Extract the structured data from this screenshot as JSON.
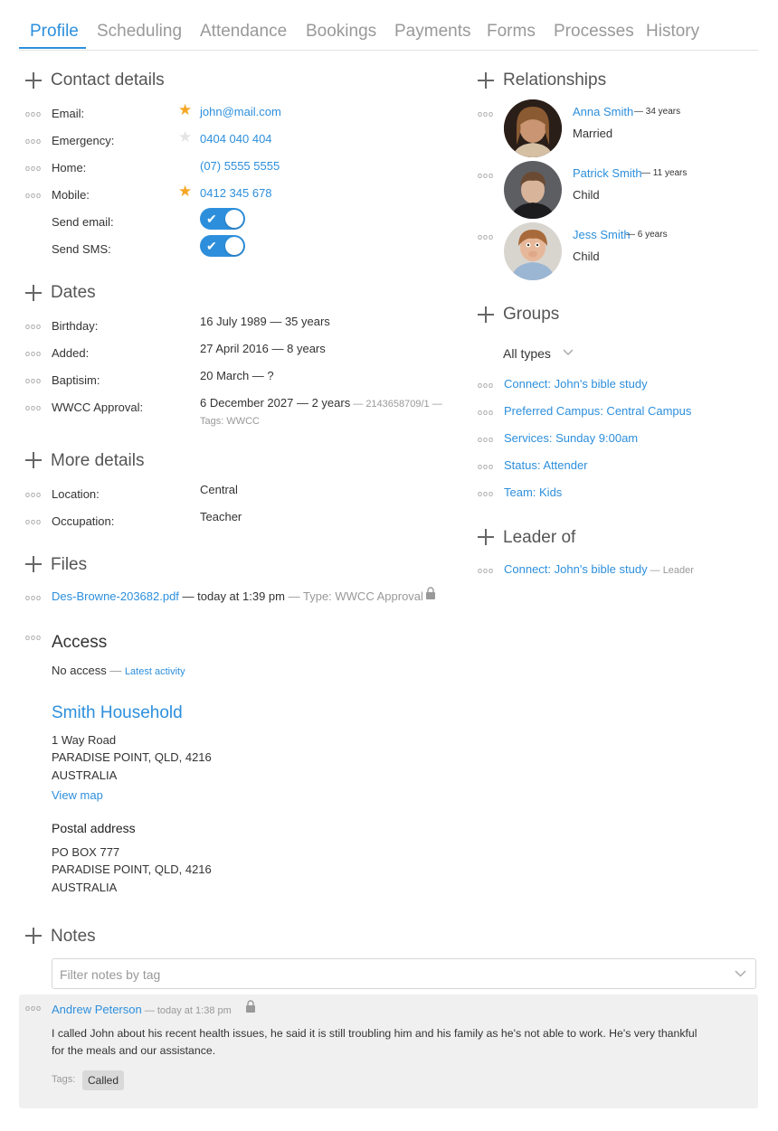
{
  "tabs": [
    "Profile",
    "Scheduling",
    "Attendance",
    "Bookings",
    "Payments",
    "Forms",
    "Processes",
    "History"
  ],
  "contact": {
    "title": "Contact details",
    "email_label": "Email:",
    "email": "john@mail.com",
    "emergency_label": "Emergency:",
    "emergency": "0404 040 404",
    "home_label": "Home:",
    "home": "(07) 5555 5555",
    "mobile_label": "Mobile:",
    "mobile": "0412 345 678",
    "send_email_label": "Send email:",
    "send_sms_label": "Send SMS:"
  },
  "dates": {
    "title": "Dates",
    "birthday_label": "Birthday:",
    "birthday": "16 July 1989 — 35 years",
    "added_label": "Added:",
    "added": "27 April 2016 — 8 years",
    "baptism_label": "Baptisim:",
    "baptism": "20 March — ?",
    "wwcc_label": "WWCC Approval:",
    "wwcc": "6 December 2027 — 2 years",
    "wwcc_extra": " — 2143658709/1 —",
    "wwcc_tags": "Tags: WWCC"
  },
  "more": {
    "title": "More details",
    "location_label": "Location:",
    "location": "Central",
    "occupation_label": "Occupation:",
    "occupation": "Teacher"
  },
  "files": {
    "title": "Files",
    "file_name": "Des-Browne-203682.pdf",
    "file_time": " — today at 1:39 pm",
    "file_type": " — Type: WWCC Approval"
  },
  "access": {
    "title": "Access",
    "status": "No access",
    "sep": " — ",
    "link": "Latest activity"
  },
  "household": {
    "title": "Smith Household",
    "line1": "1 Way Road",
    "line2": "PARADISE POINT, QLD, 4216",
    "line3": "AUSTRALIA",
    "map_link": "View map",
    "postal_title": "Postal address",
    "postal1": "PO BOX 777",
    "postal2": "PARADISE POINT, QLD, 4216",
    "postal3": "AUSTRALIA"
  },
  "relationships": {
    "title": "Relationships",
    "items": [
      {
        "name": "Anna Smith",
        "age": " — 34 years",
        "relation": "Married"
      },
      {
        "name": "Patrick Smith",
        "age": " — 11 years",
        "relation": "Child"
      },
      {
        "name": "Jess Smith",
        "age": " — 6 years",
        "relation": "Child"
      }
    ]
  },
  "groups": {
    "title": "Groups",
    "filter": "All types",
    "items": [
      "Connect: John's bible study",
      "Preferred Campus: Central Campus",
      "Services: Sunday 9:00am",
      "Status: Attender",
      "Team: Kids"
    ]
  },
  "leader": {
    "title": "Leader of",
    "group": "Connect: John's bible study",
    "role": " — Leader"
  },
  "notes": {
    "title": "Notes",
    "filter_placeholder": "Filter notes by tag",
    "author": "Andrew Peterson",
    "time": " — today at 1:38 pm",
    "body_line1": "I called John about his recent health issues, he said it is still troubling him and his family as he's not able to work. He's very thankful",
    "body_line2": "for the meals and our assistance.",
    "tags_label": "Tags:",
    "tag": "Called"
  },
  "colors": {
    "accent": "#2d8fdc",
    "star": "#f5a623",
    "note_bg": "#f0f0f0"
  }
}
